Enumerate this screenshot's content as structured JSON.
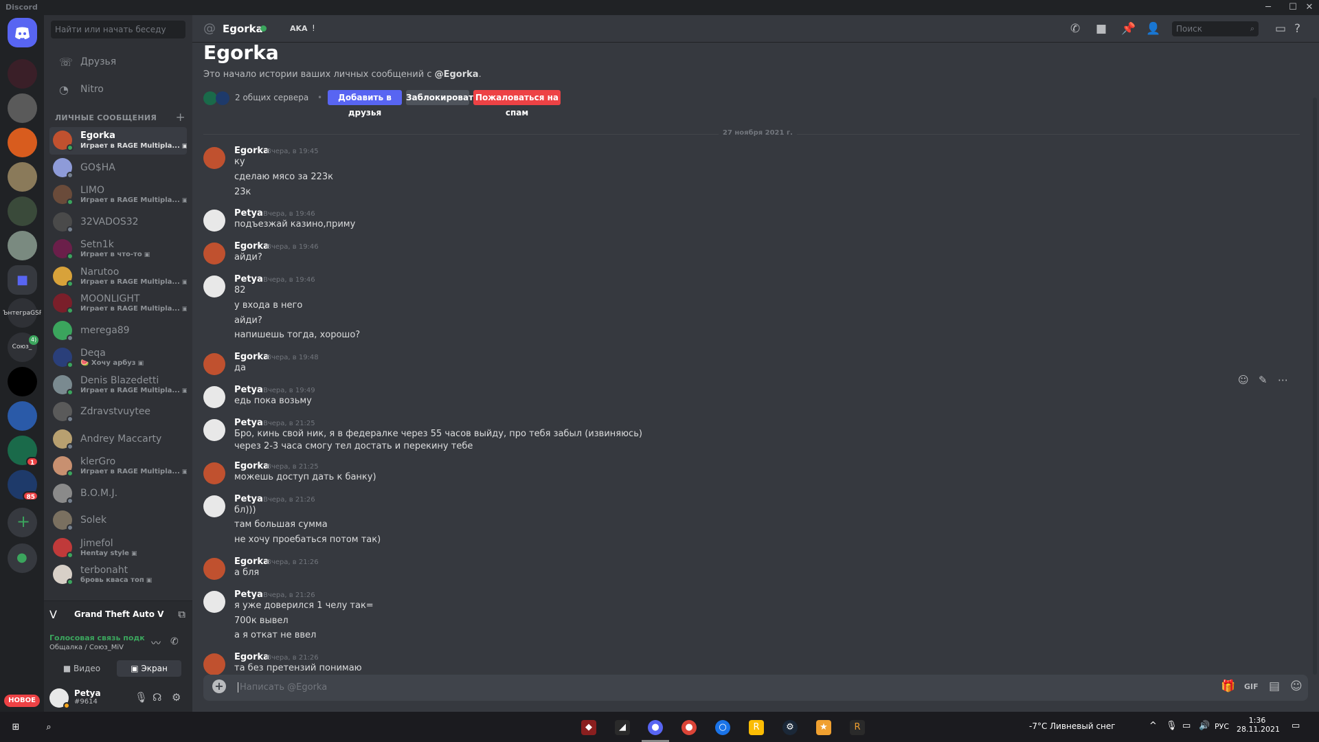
{
  "window": {
    "title": "Discord"
  },
  "colors": {
    "accent": "#5865f2",
    "online": "#3ba55d",
    "danger": "#ed4245",
    "idle": "#faa61a"
  },
  "servers": {
    "items": [
      {
        "icon": "discord-home-icon"
      },
      {
        "icon": "server-avatar"
      },
      {
        "icon": "server-avatar"
      },
      {
        "icon": "server-avatar"
      },
      {
        "icon": "server-avatar"
      },
      {
        "icon": "server-avatar"
      },
      {
        "icon": "server-avatar"
      },
      {
        "icon": "folder-icon"
      },
      {
        "label": "ЪнтегpaGSR"
      },
      {
        "label": "Союз_",
        "badge": "4)"
      },
      {
        "icon": "server-avatar"
      },
      {
        "icon": "server-avatar"
      },
      {
        "icon": "server-avatar",
        "badge": "1"
      },
      {
        "icon": "server-avatar",
        "badge": "85"
      }
    ],
    "new_badge": "НОВОЕ"
  },
  "dm_sidebar": {
    "search_placeholder": "Найти или начать беседу",
    "nav": [
      {
        "label": "Друзья",
        "icon": "friends-icon"
      },
      {
        "label": "Nitro",
        "icon": "nitro-icon"
      }
    ],
    "section_title": "ЛИЧНЫЕ СООБЩЕНИЯ",
    "dms": [
      {
        "name": "Egorka",
        "activity": "Играет в RAGE Multipla...",
        "status": "online",
        "avatar": "#c0512f",
        "active": true
      },
      {
        "name": "GO$HA",
        "activity": "",
        "status": "offline",
        "avatar": "#8e9bd8"
      },
      {
        "name": "LIMO",
        "activity": "Играет в RAGE Multipla...",
        "status": "online",
        "avatar": "#6a4b3a"
      },
      {
        "name": "32VADOS32",
        "activity": "",
        "status": "offline",
        "avatar": "#4a4a4a"
      },
      {
        "name": "Setn1k",
        "activity": "Играет в что-то",
        "status": "online",
        "avatar": "#6b1f4a"
      },
      {
        "name": "Narutoo",
        "activity": "Играет в RAGE Multipla...",
        "status": "online",
        "avatar": "#d8a23a"
      },
      {
        "name": "MOONLIGHT",
        "activity": "Играет в RAGE Multipla...",
        "status": "online",
        "avatar": "#7a1f2a"
      },
      {
        "name": "merega89",
        "activity": "",
        "status": "offline",
        "avatar": "#3ba55d"
      },
      {
        "name": "Deqa",
        "activity": "🍉 Хочу арбуз",
        "status": "online",
        "avatar": "#2a3f7a"
      },
      {
        "name": "Denis Blazedetti",
        "activity": "Играет в RAGE Multipla...",
        "status": "online",
        "avatar": "#7a8a90"
      },
      {
        "name": "Zdravstvuytee",
        "activity": "",
        "status": "offline",
        "avatar": "#5a5a5a"
      },
      {
        "name": "Andrey Maccarty",
        "activity": "",
        "status": "offline",
        "avatar": "#b8a070"
      },
      {
        "name": "klerGro",
        "activity": "Играет в RAGE Multipla...",
        "status": "online",
        "avatar": "#c89070"
      },
      {
        "name": "B.O.M.J.",
        "activity": "",
        "status": "offline",
        "avatar": "#8a8a8a"
      },
      {
        "name": "Solek",
        "activity": "",
        "status": "offline",
        "avatar": "#7a7060"
      },
      {
        "name": "Jimefol",
        "activity": "Hentay style",
        "status": "online",
        "avatar": "#c03a3a"
      },
      {
        "name": "terbonaht",
        "activity": "бровь кваса топ",
        "status": "online",
        "avatar": "#d8d0c8"
      }
    ],
    "game": {
      "title": "Grand Theft Auto V"
    },
    "voice": {
      "status": "Голосовая связь подк",
      "channel": "Общалка / Союз_MiV",
      "video_label": "Видео",
      "screen_label": "Экран"
    },
    "user": {
      "name": "Petya",
      "tag": "#9614"
    }
  },
  "header": {
    "name": "Egorka",
    "aka": "AKA",
    "aka_extra": "!",
    "search_placeholder": "Поиск"
  },
  "intro": {
    "title": "Egorka",
    "subtitle_prefix": "Это начало истории ваших личных сообщений с ",
    "subtitle_user": "@Egorka",
    "subtitle_suffix": ".",
    "mutual": "2 общих сервера",
    "dot": "•",
    "add_friend": "Добавить в друзья",
    "block": "Заблокировать",
    "report": "Пожаловаться на спам"
  },
  "date_divider": "27 ноября 2021 г.",
  "messages": [
    {
      "author": "Egorka",
      "time": "Вчера, в 19:45",
      "lines": [
        "ку",
        "сделаю мясо за 223к",
        "23к"
      ]
    },
    {
      "author": "Petya",
      "time": "Вчера, в 19:46",
      "lines": [
        "подъезжай казино,приму"
      ]
    },
    {
      "author": "Egorka",
      "time": "Вчера, в 19:46",
      "lines": [
        "айди?"
      ]
    },
    {
      "author": "Petya",
      "time": "Вчера, в 19:46",
      "lines": [
        "82",
        "у входа в него",
        "айди?",
        "напишешь тогда, хорошо?"
      ]
    },
    {
      "author": "Egorka",
      "time": "Вчера, в 19:48",
      "lines": [
        "да"
      ]
    },
    {
      "author": "Petya",
      "time": "Вчера, в 19:49",
      "lines": [
        "едь пока возьму"
      ]
    },
    {
      "author": "Petya",
      "time": "Вчера, в 21:25",
      "lines": [
        "Бро, кинь свой ник, я в федералке через 55 часов выйду, про тебя забыл (извиняюсь)",
        "через 2-3 часа смогу тел достать и перекину тебе"
      ]
    },
    {
      "author": "Egorka",
      "time": "Вчера, в 21:25",
      "lines": [
        "можешь доступ дать к банку)"
      ]
    },
    {
      "author": "Petya",
      "time": "Вчера, в 21:26",
      "lines": [
        "бл)))",
        "там большая сумма",
        "не хочу проебаться потом так)"
      ]
    },
    {
      "author": "Egorka",
      "time": "Вчера, в 21:26",
      "lines": [
        "а бля"
      ]
    },
    {
      "author": "Petya",
      "time": "Вчера, в 21:26",
      "lines": [
        "я уже доверился 1 челу так=",
        "700к вывел",
        "а я откат не ввел"
      ]
    },
    {
      "author": "Egorka",
      "time": "Вчера, в 21:26",
      "lines": [
        "та без претензий понимаю"
      ]
    }
  ],
  "composer": {
    "placeholder": "Написать @Egorka"
  },
  "taskbar": {
    "weather": "-7°C  Ливневый снег",
    "lang": "РУС",
    "time": "1:36",
    "date": "28.11.2021"
  }
}
